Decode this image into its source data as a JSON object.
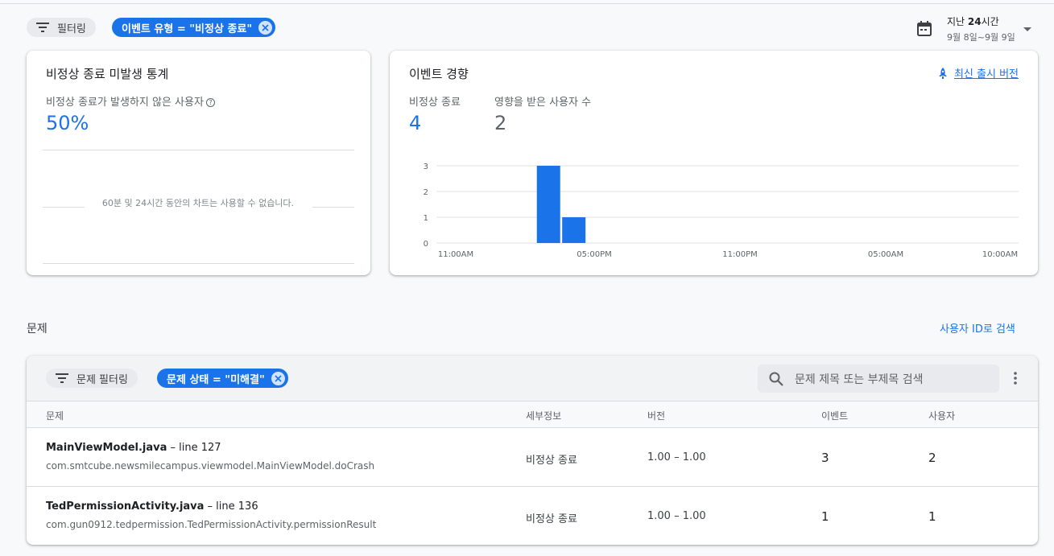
{
  "filters": {
    "filter_label": "필터링",
    "event_type_chip": "이벤트 유형 = \"비정상 종료\""
  },
  "date_range": {
    "line1_prefix": "지난 ",
    "line1_bold": "24",
    "line1_suffix": "시간",
    "line2": "9월 8일~9월 9일"
  },
  "crash_free_card": {
    "title": "비정상 종료 미발생 통계",
    "subtitle": "비정상 종료가 발생하지 않은 사용자",
    "value": "50%",
    "empty_message": "60분 및 24시간 동안의 차트는 사용할 수 없습니다."
  },
  "trend_card": {
    "title": "이벤트 경향",
    "latest_release_link": "최신 출시 버전",
    "stat1_label": "비정상 종료",
    "stat1_value": "4",
    "stat2_label": "영향을 받은 사용자 수",
    "stat2_value": "2"
  },
  "chart_data": {
    "type": "bar",
    "x_tick_labels": [
      "11:00AM",
      "05:00PM",
      "11:00PM",
      "05:00AM",
      "10:00AM"
    ],
    "y_ticks": [
      0,
      1,
      2,
      3
    ],
    "ylim": [
      0,
      3
    ],
    "xlim_hours": [
      0,
      23
    ],
    "bars": [
      {
        "x_hours_from_11am": 4,
        "value": 3
      },
      {
        "x_hours_from_11am": 5,
        "value": 1
      }
    ],
    "bar_color": "#1a73e8",
    "grid": true
  },
  "issues_section": {
    "label": "문제",
    "search_by_user_link": "사용자 ID로 검색",
    "filter_label": "문제 필터링",
    "status_chip": "문제 상태 = \"미해결\"",
    "search_placeholder": "문제 제목 또는 부제목 검색",
    "columns": [
      "문제",
      "세부정보",
      "버전",
      "이벤트",
      "사용자"
    ],
    "rows": [
      {
        "title_file": "MainViewModel.java",
        "title_line": " – line 127",
        "subtitle": "com.smtcube.newsmilecampus.viewmodel.MainViewModel.doCrash",
        "details": "비정상 종료",
        "version": "1.00 – 1.00",
        "events": "3",
        "users": "2"
      },
      {
        "title_file": "TedPermissionActivity.java",
        "title_line": " – line 136",
        "subtitle": "com.gun0912.tedpermission.TedPermissionActivity.permissionResult",
        "details": "비정상 종료",
        "version": "1.00 – 1.00",
        "events": "1",
        "users": "1"
      }
    ]
  },
  "colors": {
    "accent": "#1a73e8",
    "chip_bg": "#e8eaed"
  }
}
